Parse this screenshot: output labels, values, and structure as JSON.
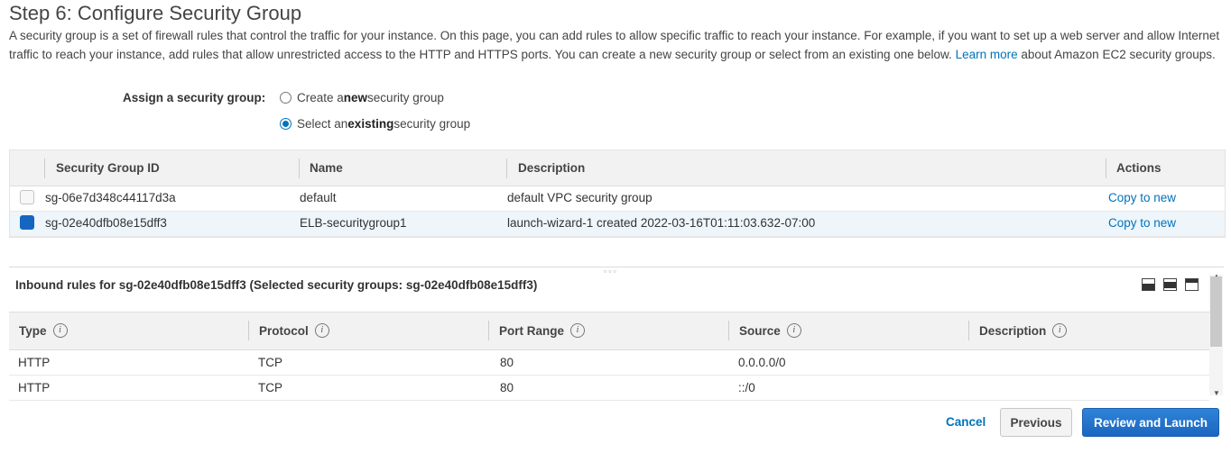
{
  "page": {
    "title": "Step 6: Configure Security Group",
    "intro_text": "A security group is a set of firewall rules that control the traffic for your instance. On this page, you can add rules to allow specific traffic to reach your instance. For example, if you want to set up a web server and allow Internet traffic to reach your instance, add rules that allow unrestricted access to the HTTP and HTTPS ports. You can create a new security group or select from an existing one below.",
    "learn_more_link": "Learn more",
    "intro_suffix": "about Amazon EC2 security groups."
  },
  "assign": {
    "label": "Assign a security group:",
    "options": [
      {
        "prefix": "Create a ",
        "bold": "new",
        "suffix": " security group",
        "selected": false
      },
      {
        "prefix": "Select an ",
        "bold": "existing",
        "suffix": " security group",
        "selected": true
      }
    ]
  },
  "security_groups": {
    "columns": [
      "Security Group ID",
      "Name",
      "Description",
      "Actions"
    ],
    "rows": [
      {
        "id": "sg-06e7d348c44117d3a",
        "name": "default",
        "description": "default VPC security group",
        "action": "Copy to new",
        "selected": false
      },
      {
        "id": "sg-02e40dfb08e15dff3",
        "name": "ELB-securitygroup1",
        "description": "launch-wizard-1 created 2022-03-16T01:11:03.632-07:00",
        "action": "Copy to new",
        "selected": true
      }
    ]
  },
  "inbound": {
    "title": "Inbound rules for sg-02e40dfb08e15dff3 (Selected security groups: sg-02e40dfb08e15dff3)",
    "view_icons": [
      "panel-bottom-icon",
      "panel-middle-icon",
      "panel-top-icon"
    ],
    "columns": [
      "Type",
      "Protocol",
      "Port Range",
      "Source",
      "Description"
    ],
    "rows": [
      {
        "type": "HTTP",
        "protocol": "TCP",
        "port_range": "80",
        "source": "0.0.0.0/0",
        "description": ""
      },
      {
        "type": "HTTP",
        "protocol": "TCP",
        "port_range": "80",
        "source": "::/0",
        "description": ""
      }
    ]
  },
  "footer": {
    "cancel": "Cancel",
    "previous": "Previous",
    "review_launch": "Review and Launch"
  },
  "colors": {
    "link": "#0073bb",
    "primary_button": "#1b66c0",
    "selected_row": "#eef5fb"
  }
}
